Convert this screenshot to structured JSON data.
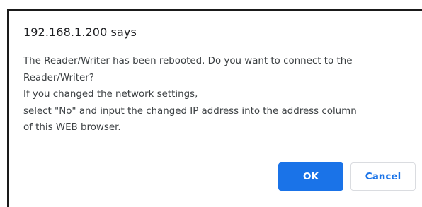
{
  "dialog": {
    "title": "192.168.1.200 says",
    "message_lines": [
      "The Reader/Writer has been rebooted. Do you want to connect to the",
      "Reader/Writer?",
      "If you changed the network settings,",
      "select \"No\" and input the changed IP address into the address column",
      "of this WEB browser."
    ],
    "ok_label": "OK",
    "cancel_label": "Cancel"
  },
  "colors": {
    "primary": "#1a73e8",
    "border": "#1a1a1a",
    "text": "#3c4043"
  }
}
